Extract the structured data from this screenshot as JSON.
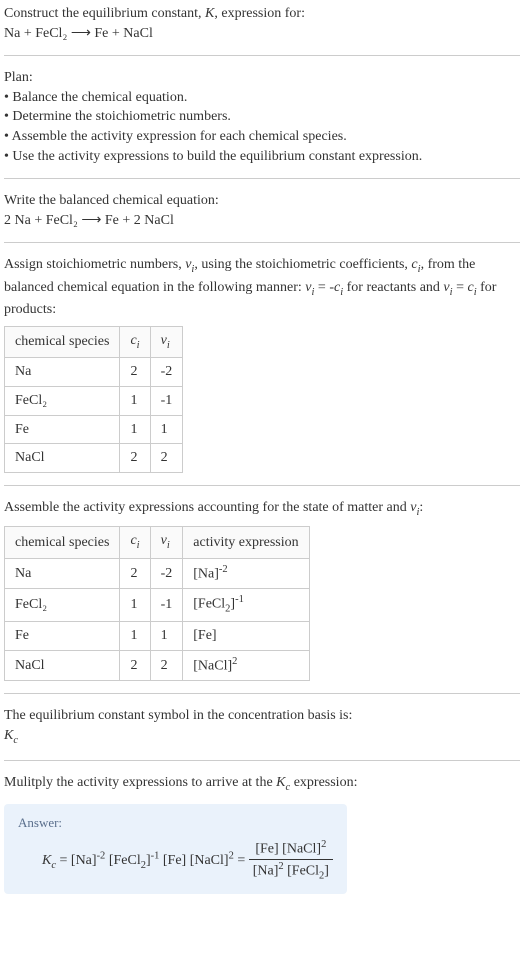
{
  "header": {
    "title_line": "Construct the equilibrium constant, K, expression for:",
    "equation": "Na + FeCl₂  ⟶  Fe + NaCl"
  },
  "plan": {
    "heading": "Plan:",
    "items": [
      "Balance the chemical equation.",
      "Determine the stoichiometric numbers.",
      "Assemble the activity expression for each chemical species.",
      "Use the activity expressions to build the equilibrium constant expression."
    ]
  },
  "balanced": {
    "heading": "Write the balanced chemical equation:",
    "equation": "2 Na + FeCl₂  ⟶  Fe + 2 NaCl"
  },
  "stoich": {
    "heading_html": "Assign stoichiometric numbers, νᵢ, using the stoichiometric coefficients, cᵢ, from the balanced chemical equation in the following manner: νᵢ = -cᵢ for reactants and νᵢ = cᵢ for products:",
    "cols": {
      "species": "chemical species",
      "ci": "cᵢ",
      "vi": "νᵢ"
    },
    "rows": [
      {
        "species": "Na",
        "ci": "2",
        "vi": "-2"
      },
      {
        "species": "FeCl₂",
        "ci": "1",
        "vi": "-1"
      },
      {
        "species": "Fe",
        "ci": "1",
        "vi": "1"
      },
      {
        "species": "NaCl",
        "ci": "2",
        "vi": "2"
      }
    ]
  },
  "activity": {
    "heading": "Assemble the activity expressions accounting for the state of matter and νᵢ:",
    "cols": {
      "species": "chemical species",
      "ci": "cᵢ",
      "vi": "νᵢ",
      "expr": "activity expression"
    },
    "rows": [
      {
        "species": "Na",
        "ci": "2",
        "vi": "-2",
        "expr": "[Na]⁻²"
      },
      {
        "species": "FeCl₂",
        "ci": "1",
        "vi": "-1",
        "expr": "[FeCl₂]⁻¹"
      },
      {
        "species": "Fe",
        "ci": "1",
        "vi": "1",
        "expr": "[Fe]"
      },
      {
        "species": "NaCl",
        "ci": "2",
        "vi": "2",
        "expr": "[NaCl]²"
      }
    ]
  },
  "kc_symbol": {
    "heading": "The equilibrium constant symbol in the concentration basis is:",
    "symbol": "K𞁞"
  },
  "multiply": {
    "heading": "Mulitply the activity expressions to arrive at the K𞁞 expression:"
  },
  "answer": {
    "label": "Answer:",
    "lhs": "K𞁞 = [Na]⁻² [FeCl₂]⁻¹ [Fe] [NaCl]² = ",
    "frac_num": "[Fe] [NaCl]²",
    "frac_den": "[Na]² [FeCl₂]"
  },
  "chart_data": {
    "type": "table",
    "tables": [
      {
        "title": "Stoichiometric numbers",
        "columns": [
          "chemical species",
          "c_i",
          "ν_i"
        ],
        "rows": [
          [
            "Na",
            2,
            -2
          ],
          [
            "FeCl2",
            1,
            -1
          ],
          [
            "Fe",
            1,
            1
          ],
          [
            "NaCl",
            2,
            2
          ]
        ]
      },
      {
        "title": "Activity expressions",
        "columns": [
          "chemical species",
          "c_i",
          "ν_i",
          "activity expression"
        ],
        "rows": [
          [
            "Na",
            2,
            -2,
            "[Na]^-2"
          ],
          [
            "FeCl2",
            1,
            -1,
            "[FeCl2]^-1"
          ],
          [
            "Fe",
            1,
            1,
            "[Fe]"
          ],
          [
            "NaCl",
            2,
            2,
            "[NaCl]^2"
          ]
        ]
      }
    ]
  }
}
